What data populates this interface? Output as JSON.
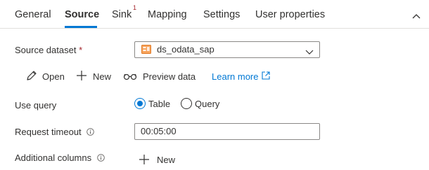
{
  "tabs": [
    {
      "label": "General",
      "active": false
    },
    {
      "label": "Source",
      "active": true
    },
    {
      "label": "Sink",
      "active": false,
      "badge": "1"
    },
    {
      "label": "Mapping",
      "active": false
    },
    {
      "label": "Settings",
      "active": false
    },
    {
      "label": "User properties",
      "active": false
    }
  ],
  "source_dataset": {
    "label": "Source dataset",
    "required_marker": "*",
    "value": "ds_odata_sap",
    "icon": "odata-dataset-icon"
  },
  "actions": {
    "open": "Open",
    "new": "New",
    "preview": "Preview data",
    "learn_more": "Learn more"
  },
  "use_query": {
    "label": "Use query",
    "options": [
      "Table",
      "Query"
    ],
    "selected": "Table"
  },
  "request_timeout": {
    "label": "Request timeout",
    "value": "00:05:00"
  },
  "additional_columns": {
    "label": "Additional columns",
    "new_label": "New"
  },
  "colors": {
    "accent": "#0078d4",
    "text": "#323130",
    "required": "#a4262c",
    "border": "#8a8886"
  }
}
